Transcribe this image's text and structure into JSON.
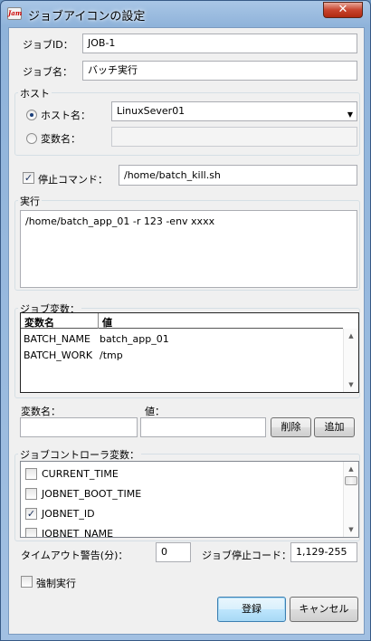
{
  "window": {
    "title": "ジョブアイコンの設定",
    "app_icon_text": "Jam",
    "close_glyph": "✕"
  },
  "job": {
    "id_label": "ジョブID：",
    "id_value": "JOB-1",
    "name_label": "ジョブ名：",
    "name_value": "バッチ実行"
  },
  "host": {
    "group_title": "ホスト",
    "hostname_label": "ホスト名：",
    "hostname_selected": true,
    "hostname_value": "LinuxSever01",
    "varname_label": "変数名：",
    "varname_selected": false,
    "varname_value": ""
  },
  "stop_command": {
    "label": "停止コマンド：",
    "checked": true,
    "value": "/home/batch_kill.sh"
  },
  "exec": {
    "group_title": "実行",
    "command": "/home/batch_app_01 -r 123 -env xxxx"
  },
  "job_vars": {
    "group_title": "ジョブ変数：",
    "columns": [
      "変数名",
      "値"
    ],
    "rows": [
      {
        "name": "BATCH_NAME",
        "value": "batch_app_01"
      },
      {
        "name": "BATCH_WORK",
        "value": "/tmp"
      }
    ],
    "var_name_label": "変数名：",
    "value_label": "値：",
    "var_name_input": "",
    "value_input": "",
    "delete_button": "削除",
    "add_button": "追加"
  },
  "controller_vars": {
    "group_title": "ジョブコントローラ変数：",
    "items": [
      {
        "name": "CURRENT_TIME",
        "checked": false
      },
      {
        "name": "JOBNET_BOOT_TIME",
        "checked": false
      },
      {
        "name": "JOBNET_ID",
        "checked": true
      },
      {
        "name": "JOBNET_NAME",
        "checked": false
      }
    ]
  },
  "timeout": {
    "label": "タイムアウト警告(分)：",
    "value": "0"
  },
  "stop_code": {
    "label": "ジョブ停止コード：",
    "value": "1,129-255"
  },
  "force": {
    "label": "強制実行",
    "checked": false
  },
  "actions": {
    "register": "登録",
    "cancel": "キャンセル"
  },
  "glyphs": {
    "check": "✓",
    "dropdown": "▼",
    "scroll_up": "▲",
    "scroll_down": "▼"
  }
}
